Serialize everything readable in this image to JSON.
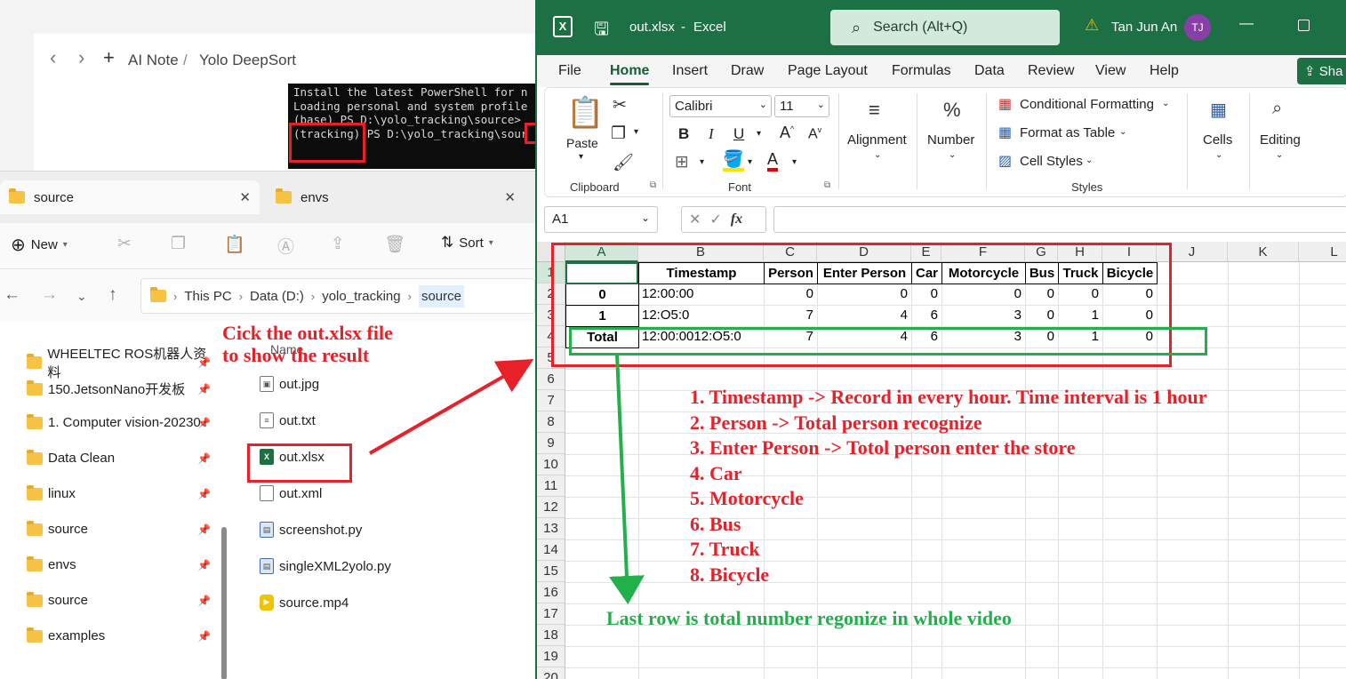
{
  "notes": {
    "breadcrumb": [
      "AI Note",
      "Yolo DeepSort"
    ],
    "terminal_lines": [
      "Install the latest PowerShell for n",
      "",
      "Loading personal and system profile",
      "(base) PS D:\\yolo_tracking\\source>",
      "(tracking) PS D:\\yolo_tracking\\sour"
    ]
  },
  "explorer": {
    "tabs": [
      {
        "label": "source",
        "active": true
      },
      {
        "label": "envs",
        "active": false
      }
    ],
    "cmd": {
      "new": "New",
      "sort": "Sort"
    },
    "address": [
      "This PC",
      "Data (D:)",
      "yolo_tracking",
      "source"
    ],
    "sidebar": [
      "WHEELTEC ROS机器人资料",
      "150.JetsonNano开发板",
      "1. Computer vision-20230",
      "Data Clean",
      "linux",
      "source",
      "envs",
      "source",
      "examples"
    ],
    "column_name": "Name",
    "files": [
      {
        "name": "out.jpg",
        "type": "img"
      },
      {
        "name": "out.txt",
        "type": "txt"
      },
      {
        "name": "out.xlsx",
        "type": "xl"
      },
      {
        "name": "out.xml",
        "type": "xml"
      },
      {
        "name": "screenshot.py",
        "type": "py"
      },
      {
        "name": "singleXML2yolo.py",
        "type": "py"
      },
      {
        "name": "source.mp4",
        "type": "mp4"
      }
    ]
  },
  "excel": {
    "filename": "out.xlsx",
    "app": "Excel",
    "search": "Search (Alt+Q)",
    "user": "Tan Jun An",
    "avatar": "TJ",
    "menu": [
      "File",
      "Home",
      "Insert",
      "Draw",
      "Page Layout",
      "Formulas",
      "Data",
      "Review",
      "View",
      "Help"
    ],
    "share": "Sha",
    "ribbon": {
      "paste": "Paste",
      "clipboard": "Clipboard",
      "font_name": "Calibri",
      "font_size": "11",
      "font_group": "Font",
      "alignment": "Alignment",
      "number": "Number",
      "cond_format": "Conditional Formatting",
      "format_table": "Format as Table",
      "cell_styles": "Cell Styles",
      "styles": "Styles",
      "cells": "Cells",
      "editing": "Editing"
    },
    "namebox": "A1",
    "columns": [
      "A",
      "B",
      "C",
      "D",
      "E",
      "F",
      "G",
      "H",
      "I",
      "J",
      "K",
      "L"
    ],
    "rows": [
      "1",
      "2",
      "3",
      "4",
      "5",
      "6",
      "7",
      "8",
      "9",
      "10",
      "11",
      "12",
      "13",
      "14",
      "15",
      "16",
      "17",
      "18",
      "19",
      "20"
    ],
    "table": {
      "headers": [
        "",
        "Timestamp",
        "Person",
        "Enter Person",
        "Car",
        "Motorcycle",
        "Bus",
        "Truck",
        "Bicycle"
      ],
      "rows": [
        [
          "0",
          "12:00:00",
          "0",
          "0",
          "0",
          "0",
          "0",
          "0",
          "0"
        ],
        [
          "1",
          "12:O5:0",
          "7",
          "4",
          "6",
          "3",
          "0",
          "1",
          "0"
        ],
        [
          "Total",
          "12:00:0012:O5:0",
          "7",
          "4",
          "6",
          "3",
          "0",
          "1",
          "0"
        ]
      ]
    }
  },
  "annotations": {
    "click_note": [
      "Cick the out.xlsx file",
      "to show the result"
    ],
    "legend": [
      "1. Timestamp -> Record in every hour. Time interval is 1 hour",
      "2. Person -> Total person recognize",
      "3. Enter Person -> Totol person enter the store",
      "4. Car",
      "5. Motorcycle",
      "6. Bus",
      "7. Truck",
      "8. Bicycle"
    ],
    "last_row": "Last row is total number regonize in whole video"
  },
  "colors": {
    "excel_green": "#1d7044",
    "annot_red": "#e8202a",
    "annot_green": "#22b04b"
  }
}
